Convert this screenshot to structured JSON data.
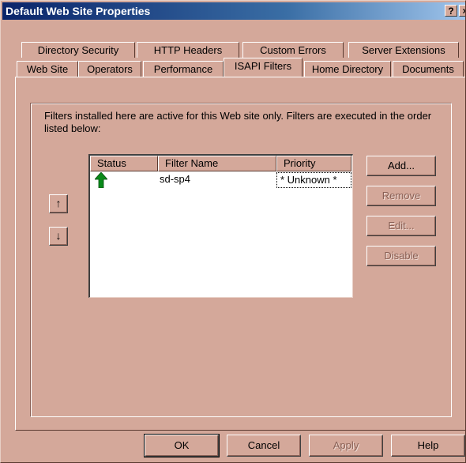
{
  "window": {
    "title": "Default Web Site Properties",
    "help_button": "?",
    "close_button": "×"
  },
  "tabs_back": [
    "Directory Security",
    "HTTP Headers",
    "Custom Errors",
    "Server Extensions"
  ],
  "tabs_front": [
    "Web Site",
    "Operators",
    "Performance",
    "ISAPI Filters",
    "Home Directory",
    "Documents"
  ],
  "active_tab": "ISAPI Filters",
  "panel": {
    "description": "Filters installed here are active for this Web site only. Filters are executed in the order listed below:",
    "columns": [
      "Status",
      "Filter Name",
      "Priority"
    ],
    "filters": [
      {
        "status_icon": "green-up-arrow-icon",
        "name": "sd-sp4",
        "priority": "* Unknown *"
      }
    ],
    "move_up_glyph": "↑",
    "move_down_glyph": "↓",
    "buttons": {
      "add": "Add...",
      "remove": "Remove",
      "edit": "Edit...",
      "disable": "Disable"
    }
  },
  "footer_buttons": {
    "ok": "OK",
    "cancel": "Cancel",
    "apply": "Apply",
    "help": "Help"
  },
  "colors": {
    "face": "#d4a89a",
    "title_start": "#0a246a",
    "status_ok": "#0a8a1a"
  }
}
